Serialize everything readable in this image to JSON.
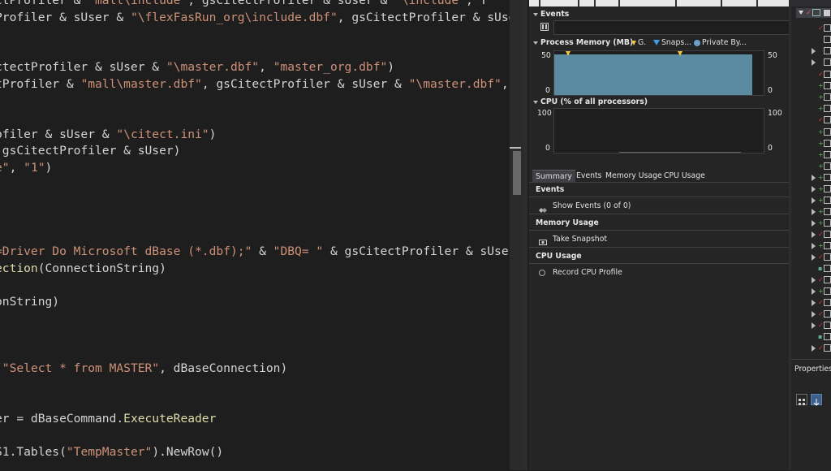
{
  "editor": {
    "lines": [
      {
        "segments": [
          {
            "t": "ctProfiler & ",
            "c": "plain"
          },
          {
            "t": "\"mall\\include\"",
            "c": "str"
          },
          {
            "t": ", gsCitectProfiler & sUser & ",
            "c": "plain"
          },
          {
            "t": "\"\\include\"",
            "c": "str"
          },
          {
            "t": ", T",
            "c": "plain"
          }
        ]
      },
      {
        "segments": [
          {
            "t": "Profiler & sUser & ",
            "c": "plain"
          },
          {
            "t": "\"\\flexFasRun_org\\include.dbf\"",
            "c": "str"
          },
          {
            "t": ", gsCitectProfiler & sUse",
            "c": "plain"
          }
        ]
      },
      {
        "segments": []
      },
      {
        "segments": []
      },
      {
        "segments": [
          {
            "t": "ctectProfiler & sUser & ",
            "c": "plain"
          },
          {
            "t": "\"\\master.dbf\"",
            "c": "str"
          },
          {
            "t": ", ",
            "c": "plain"
          },
          {
            "t": "\"master_org.dbf\"",
            "c": "str"
          },
          {
            "t": ")",
            "c": "plain"
          }
        ]
      },
      {
        "segments": [
          {
            "t": "tProfiler & ",
            "c": "plain"
          },
          {
            "t": "\"mall\\master.dbf\"",
            "c": "str"
          },
          {
            "t": ", gsCitectProfiler & sUser & ",
            "c": "plain"
          },
          {
            "t": "\"\\master.dbf\"",
            "c": "str"
          },
          {
            "t": ",",
            "c": "plain"
          }
        ]
      },
      {
        "segments": []
      },
      {
        "segments": []
      },
      {
        "segments": [
          {
            "t": "ofiler & sUser & ",
            "c": "plain"
          },
          {
            "t": "\"\\citect.ini\"",
            "c": "str"
          },
          {
            "t": ")",
            "c": "plain"
          }
        ]
      },
      {
        "segments": [
          {
            "t": " gsCitectProfiler & sUser)",
            "c": "plain"
          }
        ]
      },
      {
        "segments": [
          {
            "t": "e\"",
            "c": "str"
          },
          {
            "t": ", ",
            "c": "plain"
          },
          {
            "t": "\"1\"",
            "c": "str"
          },
          {
            "t": ")",
            "c": "plain"
          }
        ]
      },
      {
        "segments": []
      },
      {
        "segments": []
      },
      {
        "segments": []
      },
      {
        "segments": []
      },
      {
        "segments": [
          {
            "t": "=Driver Do Microsoft dBase (*.dbf);\"",
            "c": "str"
          },
          {
            "t": " & ",
            "c": "plain"
          },
          {
            "t": "\"DBQ= \"",
            "c": "str"
          },
          {
            "t": " & gsCitectProfiler & sUser",
            "c": "plain"
          }
        ]
      },
      {
        "segments": [
          {
            "t": "ection",
            "c": "fn"
          },
          {
            "t": "(ConnectionString)",
            "c": "plain"
          }
        ]
      },
      {
        "segments": []
      },
      {
        "segments": [
          {
            "t": "onString)",
            "c": "plain"
          }
        ]
      },
      {
        "segments": []
      },
      {
        "segments": []
      },
      {
        "segments": []
      },
      {
        "segments": [
          {
            "t": "(",
            "c": "plain"
          },
          {
            "t": "\"Select * from MASTER\"",
            "c": "str"
          },
          {
            "t": ", dBaseConnection)",
            "c": "plain"
          }
        ]
      },
      {
        "segments": []
      },
      {
        "segments": []
      },
      {
        "segments": [
          {
            "t": "er = dBaseCommand.",
            "c": "plain"
          },
          {
            "t": "ExecuteReader",
            "c": "fn"
          }
        ]
      },
      {
        "segments": []
      },
      {
        "segments": [
          {
            "t": "S1.Tables(",
            "c": "plain"
          },
          {
            "t": "\"TempMaster\"",
            "c": "str"
          },
          {
            "t": ").NewRow()",
            "c": "plain"
          }
        ]
      }
    ]
  },
  "diagnostics": {
    "events_title": "Events",
    "memory_title": "Process Memory (MB)",
    "memory_legend": [
      {
        "label": "G.",
        "icon": "gc-marker-icon",
        "color": "#f0c43f"
      },
      {
        "label": "Snaps...",
        "icon": "snapshot-marker-icon",
        "color": "#3d9ee8"
      },
      {
        "label": "Private By...",
        "icon": "private-bytes-dot-icon",
        "color": "#6ba0c8"
      }
    ],
    "memory_axis": {
      "max": "50",
      "min": "0"
    },
    "cpu_title": "CPU (% of all processors)",
    "cpu_axis": {
      "max": "100",
      "min": "0"
    },
    "tabs": [
      "Summary",
      "Events",
      "Memory Usage",
      "CPU Usage"
    ],
    "summary": {
      "events_head": "Events",
      "show_events": "Show Events (0 of 0)",
      "memory_head": "Memory Usage",
      "take_snapshot": "Take Snapshot",
      "cpu_head": "CPU Usage",
      "record_cpu": "Record CPU Profile"
    }
  },
  "properties": {
    "title": "Properties"
  }
}
